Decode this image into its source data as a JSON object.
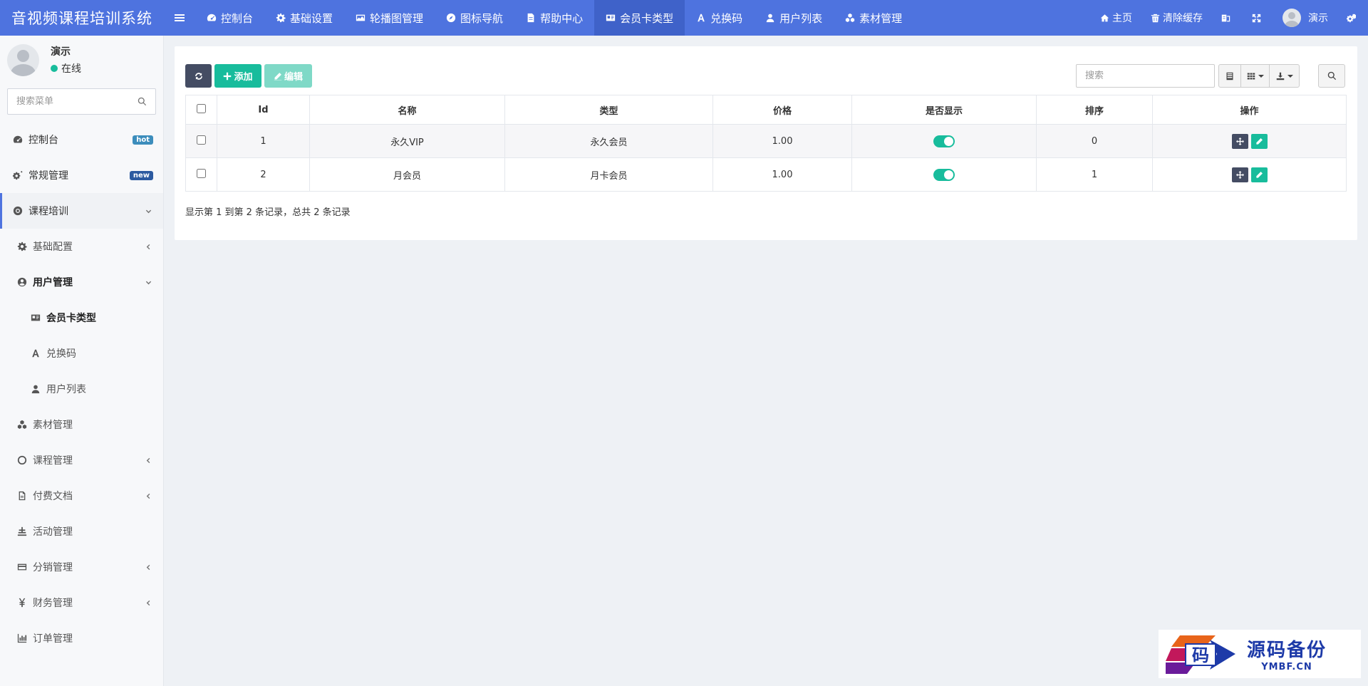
{
  "brand": "音视频课程培训系统",
  "topnav": [
    {
      "label": "控制台",
      "icon": "dashboard-icon",
      "active": false
    },
    {
      "label": "基础设置",
      "icon": "gear-icon",
      "active": false
    },
    {
      "label": "轮播图管理",
      "icon": "image-icon",
      "active": false
    },
    {
      "label": "图标导航",
      "icon": "compass-icon",
      "active": false
    },
    {
      "label": "帮助中心",
      "icon": "document-icon",
      "active": false
    },
    {
      "label": "会员卡类型",
      "icon": "id-card-icon",
      "active": true
    },
    {
      "label": "兑换码",
      "icon": "font-icon",
      "active": false
    },
    {
      "label": "用户列表",
      "icon": "user-icon",
      "active": false
    },
    {
      "label": "素材管理",
      "icon": "cubes-icon",
      "active": false
    }
  ],
  "topright": {
    "home": "主页",
    "clear_cache": "清除缓存",
    "username": "演示"
  },
  "sidebar": {
    "user_name": "演示",
    "status": "在线",
    "search_placeholder": "搜索菜单",
    "items": [
      {
        "label": "控制台",
        "badge": "hot"
      },
      {
        "label": "常规管理",
        "badge": "new"
      },
      {
        "label": "课程培训"
      },
      {
        "label": "基础配置"
      },
      {
        "label": "用户管理"
      },
      {
        "label": "会员卡类型"
      },
      {
        "label": "兑换码"
      },
      {
        "label": "用户列表"
      },
      {
        "label": "素材管理"
      },
      {
        "label": "课程管理"
      },
      {
        "label": "付费文档"
      },
      {
        "label": "活动管理"
      },
      {
        "label": "分销管理"
      },
      {
        "label": "财务管理"
      },
      {
        "label": "订单管理"
      }
    ]
  },
  "toolbar": {
    "add": "添加",
    "edit": "编辑",
    "search_placeholder": "搜索"
  },
  "table": {
    "headers": [
      "Id",
      "名称",
      "类型",
      "价格",
      "是否显示",
      "排序",
      "操作"
    ],
    "rows": [
      {
        "id": "1",
        "name": "永久VIP",
        "type": "永久会员",
        "price": "1.00",
        "show": true,
        "sort": "0"
      },
      {
        "id": "2",
        "name": "月会员",
        "type": "月卡会员",
        "price": "1.00",
        "show": true,
        "sort": "1"
      }
    ]
  },
  "pager": "显示第 1 到第 2 条记录，总共 2 条记录",
  "logo": {
    "cn": "源码备份",
    "en": "YMBF.CN",
    "glyph": "码"
  },
  "colors": {
    "topbar": "#4e73df",
    "accent": "#18bc9c",
    "dark": "#444c63"
  }
}
